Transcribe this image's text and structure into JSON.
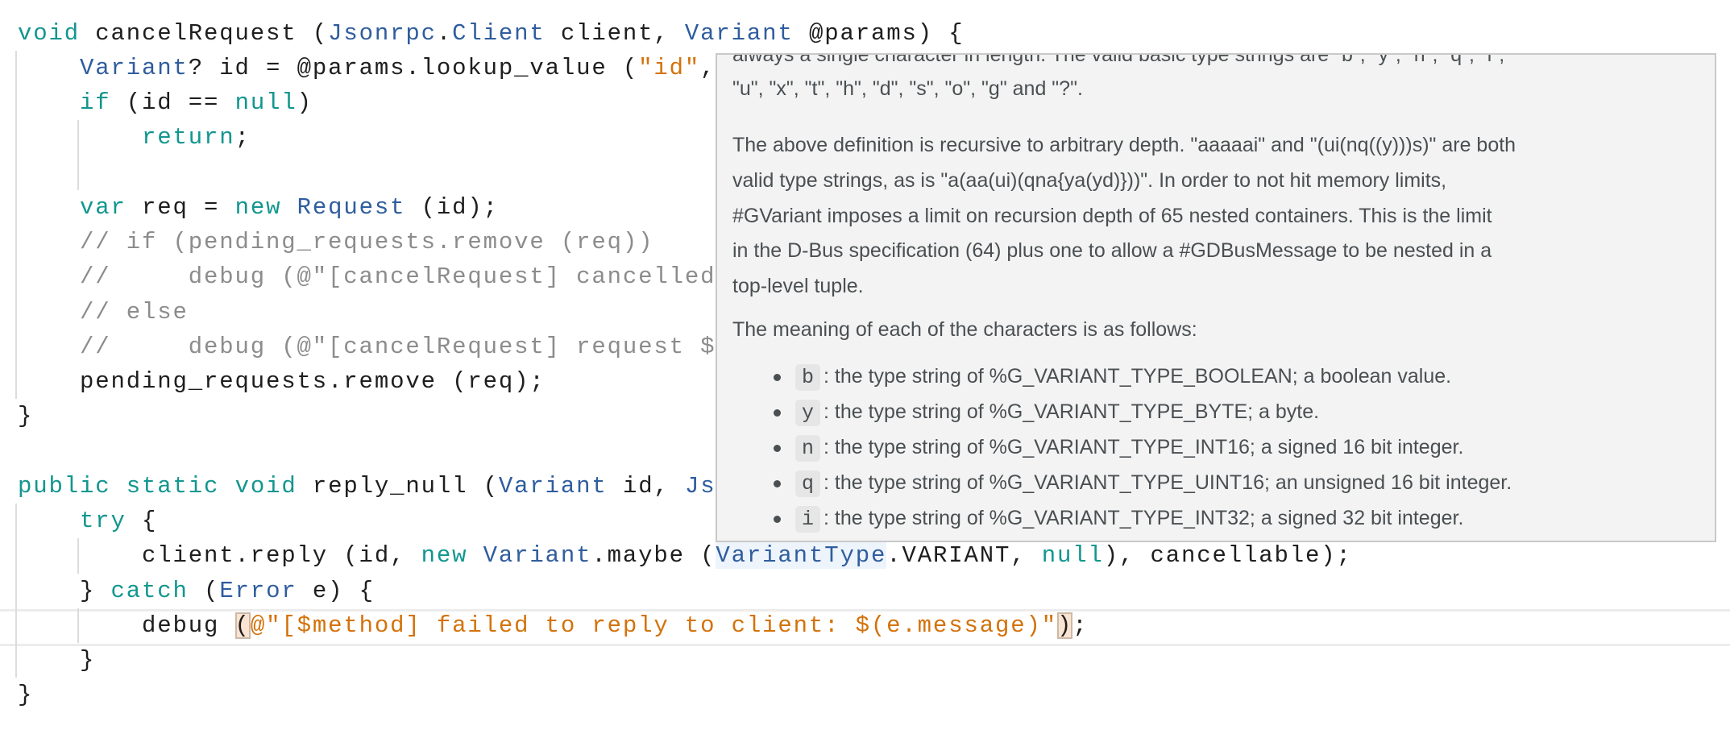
{
  "colors": {
    "keyword": "#12968f",
    "type": "#2f5d9e",
    "string": "#d4720a",
    "comment": "#8c8c8c",
    "tooltip_bg": "#f3f3f3"
  },
  "code_lines": [
    [
      [
        "void",
        "k"
      ],
      [
        " cancelRequest (",
        "p"
      ],
      [
        "Jsonrpc",
        "t"
      ],
      [
        ".",
        "p"
      ],
      [
        "Client",
        "t"
      ],
      [
        " client, ",
        "p"
      ],
      [
        "Variant",
        "t"
      ],
      [
        " @params) {",
        "p"
      ]
    ],
    [
      [
        "    ",
        "p"
      ],
      [
        "Variant",
        "t"
      ],
      [
        "? id = @params.lookup_value (",
        "p"
      ],
      [
        "\"id\"",
        "s"
      ],
      [
        ",",
        "p"
      ]
    ],
    [
      [
        "    ",
        "p"
      ],
      [
        "if",
        "k"
      ],
      [
        " (id == ",
        "p"
      ],
      [
        "null",
        "k"
      ],
      [
        ")",
        "p"
      ]
    ],
    [
      [
        "        ",
        "p"
      ],
      [
        "return",
        "k"
      ],
      [
        ";",
        "p"
      ]
    ],
    [],
    [
      [
        "    ",
        "p"
      ],
      [
        "var",
        "k"
      ],
      [
        " req = ",
        "p"
      ],
      [
        "new",
        "k"
      ],
      [
        " ",
        "p"
      ],
      [
        "Request",
        "t"
      ],
      [
        " (id);",
        "p"
      ]
    ],
    [
      [
        "    // if (pending_requests.remove (req))",
        "c"
      ]
    ],
    [
      [
        "    //     debug (@\"[cancelRequest] cancelled",
        "c"
      ]
    ],
    [
      [
        "    // else",
        "c"
      ]
    ],
    [
      [
        "    //     debug (@\"[cancelRequest] request $",
        "c"
      ]
    ],
    [
      [
        "    pending_requests.remove (req);",
        "p"
      ]
    ],
    [
      [
        "}",
        "p"
      ]
    ],
    [],
    [
      [
        "public",
        "k"
      ],
      [
        " ",
        "p"
      ],
      [
        "static",
        "k"
      ],
      [
        " ",
        "p"
      ],
      [
        "void",
        "k"
      ],
      [
        " reply_null (",
        "p"
      ],
      [
        "Variant",
        "t"
      ],
      [
        " id, ",
        "p"
      ],
      [
        "Js",
        "t"
      ]
    ],
    [
      [
        "    ",
        "p"
      ],
      [
        "try",
        "k"
      ],
      [
        " {",
        "p"
      ]
    ],
    [
      [
        "        client.reply (id, ",
        "p"
      ],
      [
        "new",
        "k"
      ],
      [
        " ",
        "p"
      ],
      [
        "Variant",
        "t"
      ],
      [
        ".maybe (",
        "p"
      ],
      [
        "VariantType",
        "t hl-type"
      ],
      [
        ".VARIANT, ",
        "p"
      ],
      [
        "null",
        "k"
      ],
      [
        "), cancellable);",
        "p"
      ]
    ],
    [
      [
        "    } ",
        "p"
      ],
      [
        "catch",
        "k"
      ],
      [
        " (",
        "p"
      ],
      [
        "Error",
        "t"
      ],
      [
        " e) {",
        "p"
      ]
    ],
    [
      [
        "        debug ",
        "p"
      ],
      [
        "(",
        "p bracket"
      ],
      [
        "@\"[$method] failed to reply to client: $(e.message)\"",
        "s"
      ],
      [
        ")",
        "p bracket"
      ],
      [
        ";",
        "p"
      ]
    ],
    [
      [
        "    }",
        "p"
      ]
    ],
    [
      [
        "}",
        "p"
      ]
    ]
  ],
  "tooltip": {
    "clipped_line": "always a single character in length. The valid basic type strings are \"b\", \"y\", \"n\", \"q\", \"i\",",
    "line1": "\"u\", \"x\", \"t\", \"h\", \"d\", \"s\", \"o\", \"g\" and \"?\".",
    "para2": [
      "The above definition is recursive to arbitrary depth. \"aaaaai\" and \"(ui(nq((y)))s)\" are both",
      "valid type strings, as is \"a(aa(ui)(qna{ya(yd)}))\". In order to not hit memory limits,",
      "#GVariant imposes a limit on recursion depth of 65 nested containers. This is the limit",
      "in the D-Bus specification (64) plus one to allow a #GDBusMessage to be nested in a",
      "top-level tuple."
    ],
    "para3": "The meaning of each of the characters is as follows:",
    "bullets": [
      {
        "code": "b",
        "text": ": the type string of %G_VARIANT_TYPE_BOOLEAN; a boolean value."
      },
      {
        "code": "y",
        "text": ": the type string of %G_VARIANT_TYPE_BYTE; a byte."
      },
      {
        "code": "n",
        "text": ": the type string of %G_VARIANT_TYPE_INT16; a signed 16 bit integer."
      },
      {
        "code": "q",
        "text": ": the type string of %G_VARIANT_TYPE_UINT16; an unsigned 16 bit integer."
      },
      {
        "code": "i",
        "text": ": the type string of %G_VARIANT_TYPE_INT32; a signed 32 bit integer."
      }
    ]
  }
}
